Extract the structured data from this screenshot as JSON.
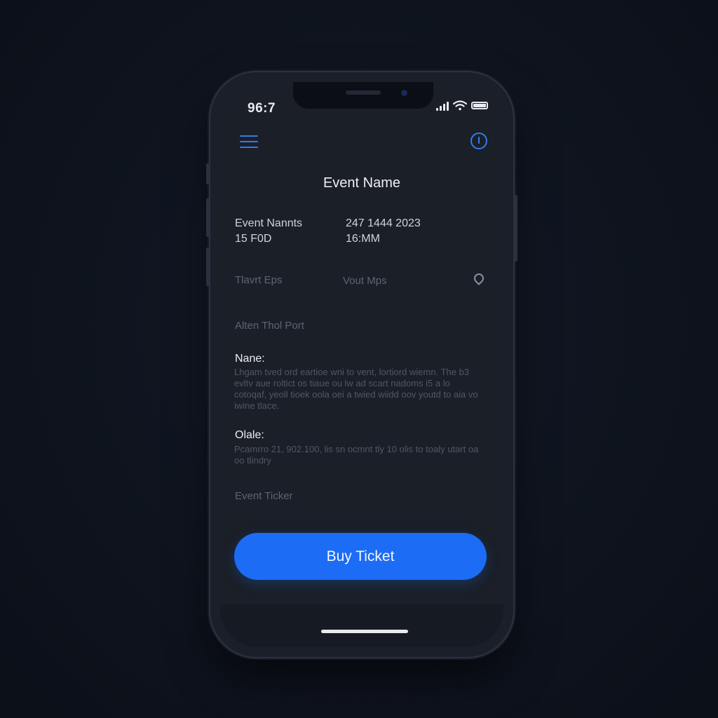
{
  "status_bar": {
    "time": "96:7"
  },
  "header": {
    "title": "Event Name"
  },
  "details": {
    "left_line1": "Event Nannts",
    "left_line2": "15 F0D",
    "right_line1": "247 1444 2023",
    "right_line2": "16:MM",
    "venue_left": "Tlavrt Eps",
    "venue_right": "Vout Mps",
    "section_hint": "Alten Thol Port"
  },
  "description": {
    "name_label": "Nane:",
    "name_text": "Lhgam tved ord eartioe wni to vent, lortiord wiemn. The b3 evltv aue roltict os tiaue ou lw ad scart nadoms i5 a lo cotoqaf, yeoll tioek oola oei a twied wiidd oov youtd to aia vo iwine tlace.",
    "date_label": "Olale:",
    "date_text": "Pcamrro 21, 902.100, lis sn ocmnt tly 10 olis to toaly utart oa oo tlindry",
    "footer_label": "Event Ticker"
  },
  "actions": {
    "buy_label": "Buy Ticket"
  },
  "colors": {
    "accent": "#1c6cf5",
    "background": "#1b1f27"
  },
  "icons": [
    "menu-icon",
    "info-icon",
    "location-pin-icon",
    "signal-icon",
    "wifi-icon",
    "battery-icon"
  ]
}
